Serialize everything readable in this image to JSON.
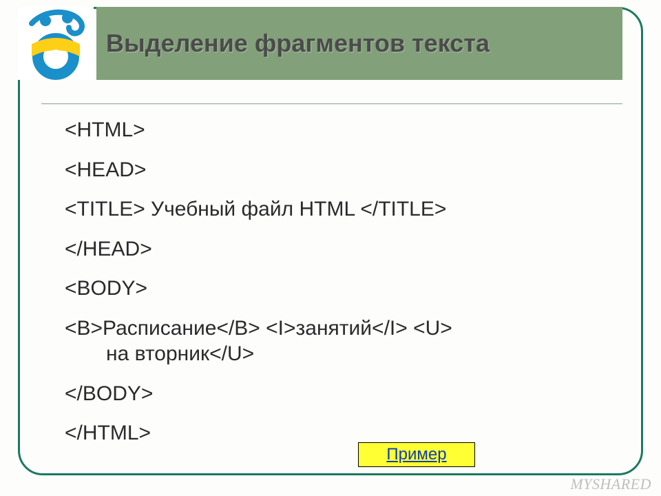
{
  "slide": {
    "title": "Выделение фрагментов текста",
    "code": {
      "line1": "<HTML>",
      "line2": "<HEAD>",
      "line3": "<TITLE> Учебный файл HTML </TITLE>",
      "line4": "</HEAD>",
      "line5": "<BODY>",
      "line6a": "<B>Расписание</B> <I>занятий</I> <U>",
      "line6b": "на вторник</U>",
      "line7": "</BODY>",
      "line8": "</HTML>"
    },
    "example_label": "Пример"
  },
  "watermark": "MYSHARED"
}
